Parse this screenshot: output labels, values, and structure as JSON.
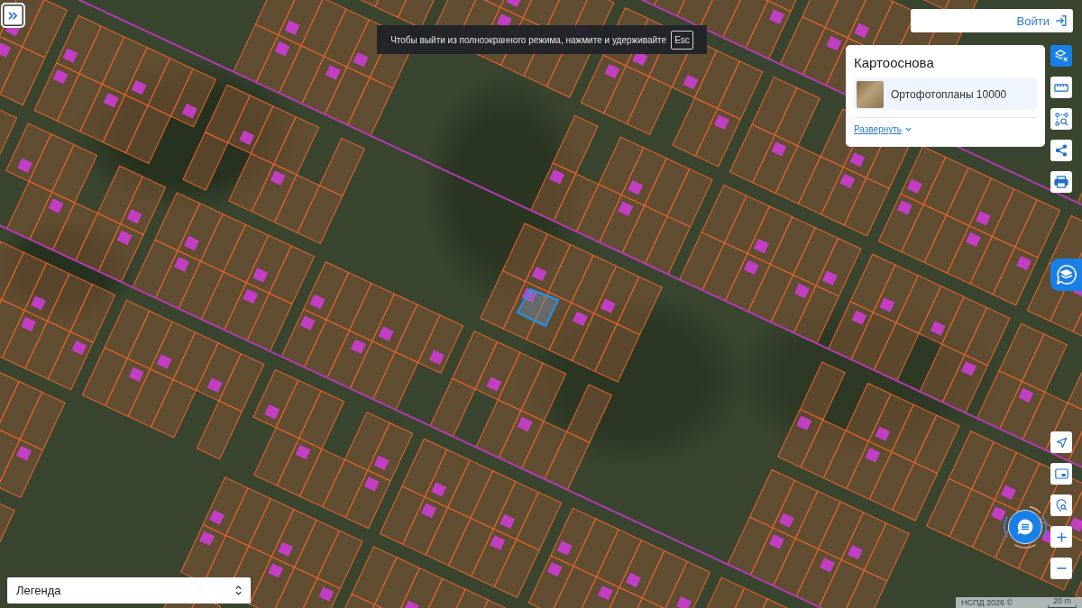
{
  "fullscreen_notice": {
    "text": "Чтобы выйти из полноэкранного режима, нажмите и удерживайте",
    "key": "Esc"
  },
  "login_button": {
    "label": "Войти"
  },
  "basemap_panel": {
    "title": "Картооснова",
    "layers": [
      {
        "name": "Ортофотопланы 10000"
      }
    ],
    "expand_link": "Развернуть"
  },
  "toolbar": [
    {
      "kind": "layers",
      "selected": true
    },
    {
      "kind": "ruler",
      "selected": false
    },
    {
      "kind": "select-area",
      "selected": false
    },
    {
      "kind": "share",
      "selected": false
    },
    {
      "kind": "print",
      "selected": false
    }
  ],
  "map_controls": [
    {
      "kind": "locate"
    },
    {
      "kind": "minimap"
    },
    {
      "kind": "find-place"
    },
    {
      "kind": "zoom-in"
    },
    {
      "kind": "zoom-out"
    }
  ],
  "legend": {
    "label": "Легенда"
  },
  "attribution": {
    "copyright": "НСПД 2026 ©",
    "scale": "20 m"
  }
}
